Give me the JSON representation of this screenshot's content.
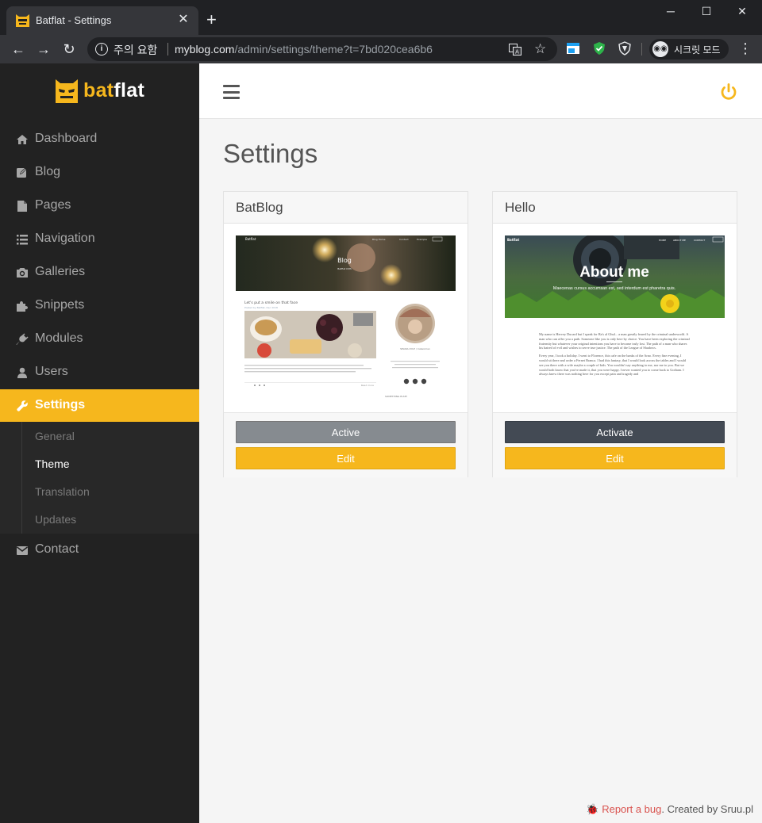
{
  "browser": {
    "tab_title": "Batflat - Settings",
    "tab_close": "✕",
    "new_tab": "+",
    "security_label": "주의 요함",
    "url_host": "myblog.com",
    "url_path": "/admin/settings/theme?t=7bd020cea6b6",
    "incognito_label": "시크릿 모드",
    "window_controls": {
      "minimize": "─",
      "maximize": "☐",
      "close": "✕"
    }
  },
  "brand": {
    "name_part1": "bat",
    "name_part2": "flat",
    "accent_color": "#f6b71d"
  },
  "sidebar": {
    "items": [
      {
        "label": "Dashboard",
        "icon": "home-icon"
      },
      {
        "label": "Blog",
        "icon": "edit-icon"
      },
      {
        "label": "Pages",
        "icon": "file-icon"
      },
      {
        "label": "Navigation",
        "icon": "list-icon"
      },
      {
        "label": "Galleries",
        "icon": "camera-icon"
      },
      {
        "label": "Snippets",
        "icon": "puzzle-icon"
      },
      {
        "label": "Modules",
        "icon": "plug-icon"
      },
      {
        "label": "Users",
        "icon": "user-icon"
      },
      {
        "label": "Settings",
        "icon": "wrench-icon",
        "active": true
      },
      {
        "label": "Contact",
        "icon": "envelope-icon"
      }
    ],
    "settings_subitems": [
      {
        "label": "General"
      },
      {
        "label": "Theme",
        "current": true
      },
      {
        "label": "Translation"
      },
      {
        "label": "Updates"
      }
    ]
  },
  "main": {
    "title": "Settings",
    "themes": [
      {
        "name": "BatBlog",
        "status_button": "Active",
        "edit_button": "Edit",
        "preview": {
          "brand": "Batflat",
          "nav": [
            "Blog Home",
            "Contact",
            "Example"
          ],
          "hero_title": "Blog",
          "hero_sub": "Batflat CMS",
          "post_title": "Let's put a smile on that face",
          "post_meta": "Posted by Batflat, Dec 2018",
          "profile_caption": "SELINA KYLE / Catwoman",
          "sidebar_heading": "SOMETHING ELSE?",
          "read_more": "Read more"
        }
      },
      {
        "name": "Hello",
        "status_button": "Activate",
        "edit_button": "Edit",
        "preview": {
          "brand": "Batflat",
          "nav": [
            "HOME",
            "ABOUT ME",
            "CONTACT"
          ],
          "hero_title": "About me",
          "hero_sub": "Maecenas cursus accumsan est, sed interdum est pharetra quis.",
          "paragraphs": [
            "My name is Hervey Ducard but I speak for Ra's al Ghul... a man greatly feared by the criminal underworld. A man who can offer you a path. Someone like you is only here by choice. You have been exploring the criminal fraternity but whatever your original intentions you have to become truly lost. The path of a man who shares his hatred of evil and wishes to serve true justice. The path of the League of Shadows.",
            "Every year, I took a holiday. I went to Florence, this cafe on the banks of the Arno. Every fine evening, I would sit there and order a Fernet Branca. I had this fantasy, that I would look across the tables and I would see you there with a wife maybe a couple of kids. You wouldn't say anything to me, nor me to you. But we would both know that you've made it, that you were happy. I never wanted you to come back to Gotham. I always knew there was nothing here for you except pain and tragedy and"
          ]
        }
      }
    ]
  },
  "footer": {
    "bug_label": "Report a bug",
    "created_by": ". Created by Sruu.pl"
  }
}
